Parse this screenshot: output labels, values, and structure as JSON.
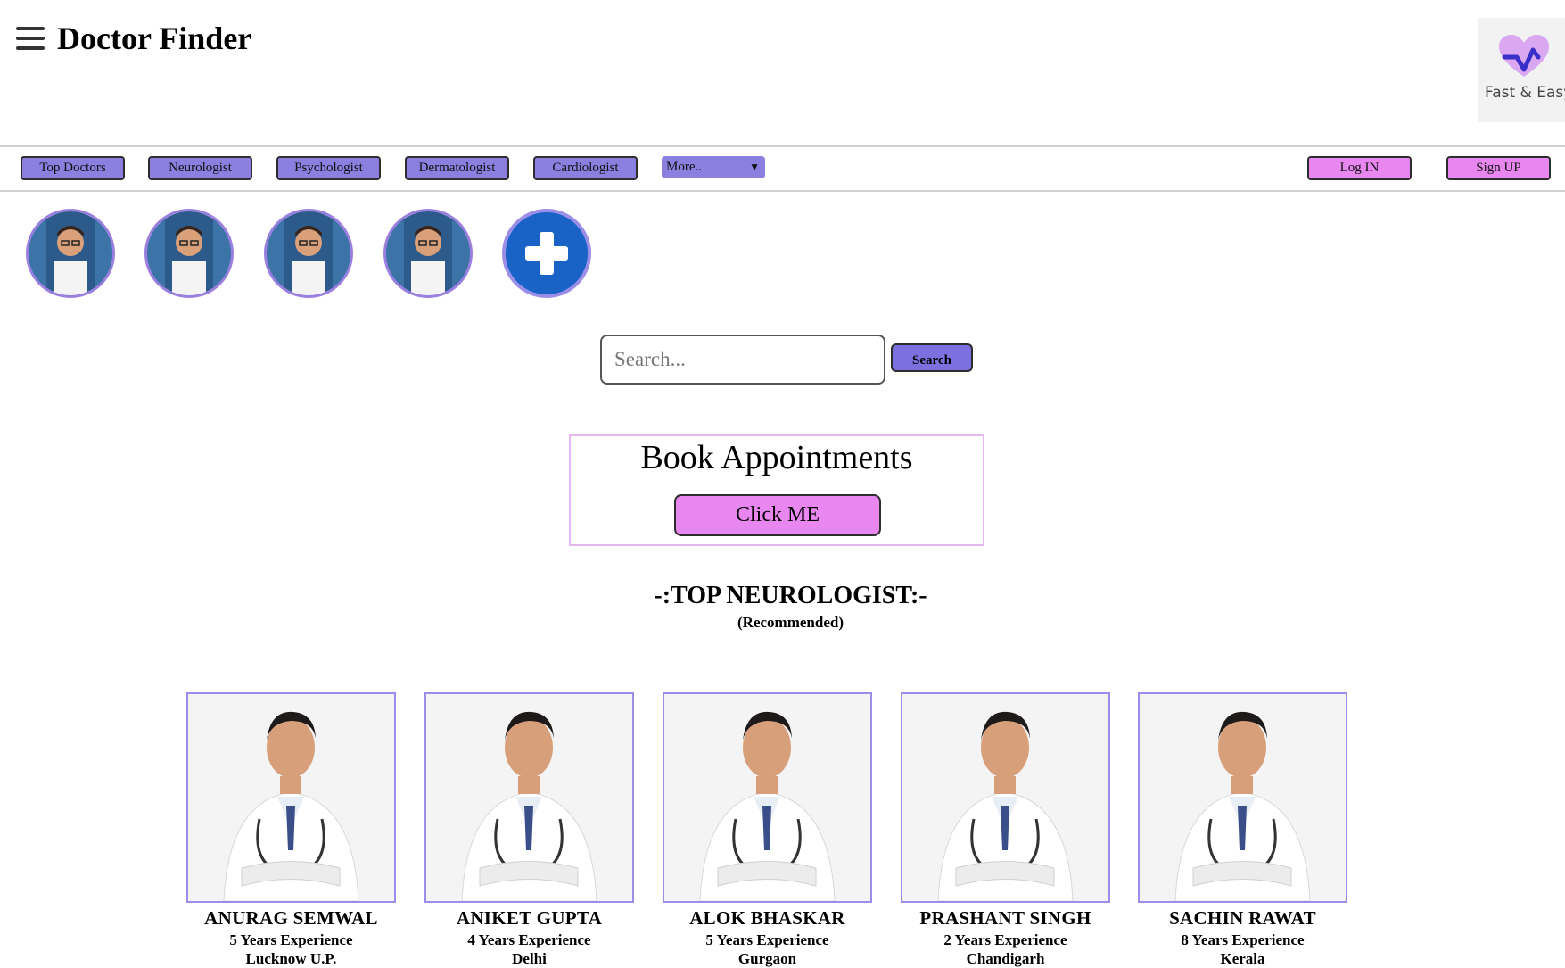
{
  "header": {
    "title": "Doctor Finder",
    "logo_tagline": "Fast & Easy"
  },
  "nav": {
    "items": [
      "Top Doctors",
      "Neurologist",
      "Psychologist",
      "Dermatologist",
      "Cardiologist"
    ],
    "more_select": "More..",
    "login": "Log IN",
    "signup": "Sign UP"
  },
  "search": {
    "placeholder": "Search...",
    "button": "Search"
  },
  "book": {
    "title": "Book Appointments",
    "button": "Click ME"
  },
  "section": {
    "title": "-:TOP NEUROLOGIST:-",
    "subtitle": "(Recommended)"
  },
  "doctors": [
    {
      "name": "ANURAG SEMWAL",
      "experience": "5 Years Experience",
      "location": "Lucknow U.P."
    },
    {
      "name": "ANIKET GUPTA",
      "experience": "4 Years Experience",
      "location": "Delhi"
    },
    {
      "name": "ALOK BHASKAR",
      "experience": "5 Years Experience",
      "location": "Gurgaon"
    },
    {
      "name": "PRASHANT SINGH",
      "experience": "2 Years Experience",
      "location": "Chandigarh"
    },
    {
      "name": "SACHIN RAWAT",
      "experience": "8 Years Experience",
      "location": "Kerala"
    }
  ],
  "colors": {
    "nav_button": "#8b7fe0",
    "auth_button": "#e887f0",
    "card_border": "#9b8ee8",
    "plus_avatar": "#1a63c6"
  }
}
